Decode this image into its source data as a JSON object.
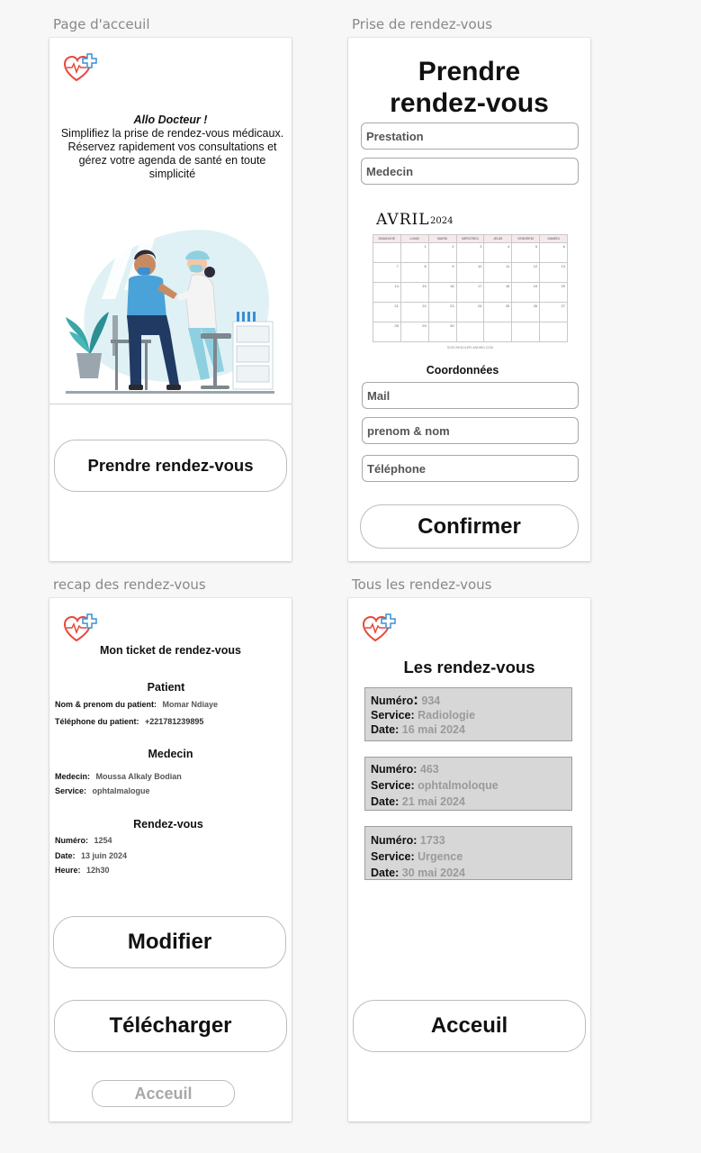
{
  "frames": {
    "home": {
      "label": "Page d'acceuil",
      "title": "Allo Docteur !",
      "description_lines": [
        "Simplifiez la prise de rendez-vous médicaux.",
        "Réservez rapidement vos consultations et",
        "gérez votre agenda de santé en toute",
        "simplicité"
      ],
      "cta_label": "Prendre rendez-vous"
    },
    "booking": {
      "label": "Prise de rendez-vous",
      "title_line1": "Prendre",
      "title_line2": "rendez-vous",
      "prestation_placeholder": "Prestation",
      "medecin_placeholder": "Medecin",
      "calendar": {
        "month": "AVRIL",
        "year": "2024",
        "weekdays": [
          "DIMANCHE",
          "LUNDI",
          "MARDI",
          "MERCREDI",
          "JEUDI",
          "VENDREDI",
          "SAMEDI"
        ],
        "weeks": [
          [
            "",
            "1",
            "2",
            "3",
            "4",
            "5",
            "6"
          ],
          [
            "7",
            "8",
            "9",
            "10",
            "11",
            "12",
            "13"
          ],
          [
            "14",
            "15",
            "16",
            "17",
            "18",
            "19",
            "20"
          ],
          [
            "21",
            "22",
            "23",
            "24",
            "25",
            "26",
            "27"
          ],
          [
            "28",
            "29",
            "30",
            "",
            "",
            "",
            ""
          ]
        ],
        "footer": "SOSCHEDULEPLANNING.COM"
      },
      "coordonnees_heading": "Coordonnées",
      "mail_placeholder": "Mail",
      "name_placeholder": "prenom & nom",
      "phone_placeholder": "Téléphone",
      "confirm_label": "Confirmer"
    },
    "recap": {
      "label": "recap des rendez-vous",
      "title": "Mon ticket de rendez-vous",
      "patient_heading": "Patient",
      "patient_name_label": "Nom & prenom du patient:",
      "patient_name": "Momar Ndiaye",
      "patient_phone_label": "Téléphone du patient:",
      "patient_phone": "+221781239895",
      "medecin_heading": "Medecin",
      "medecin_label": "Medecin:",
      "medecin_name": "Moussa Alkaly Bodian",
      "service_label": "Service:",
      "service_value": "ophtalmalogue",
      "rdv_heading": "Rendez-vous",
      "numero_label": "Numéro:",
      "numero_value": "1254",
      "date_label": "Date:",
      "date_value": "13 juin 2024",
      "heure_label": "Heure:",
      "heure_value": "12h30",
      "modify_label": "Modifier",
      "download_label": "Télécharger",
      "home_label": "Acceuil"
    },
    "list": {
      "label": "Tous les rendez-vous",
      "title": "Les rendez-vous",
      "numero_label": "Numéro",
      "service_label": "Service:",
      "date_label": "Date:",
      "items": [
        {
          "numero": "934",
          "service": "Radiologie",
          "date": "16 mai 2024"
        },
        {
          "numero": "463",
          "service": "ophtalmoloque",
          "date": "21 mai 2024"
        },
        {
          "numero": "1733",
          "service": "Urgence",
          "date": "30 mai 2024"
        }
      ],
      "home_label": "Acceuil"
    }
  },
  "colors": {
    "logo_heart": "#e8473c",
    "logo_cross": "#3a8fd6",
    "illustration_blob": "#dff1f4",
    "card_bg": "#d7d7d7"
  }
}
